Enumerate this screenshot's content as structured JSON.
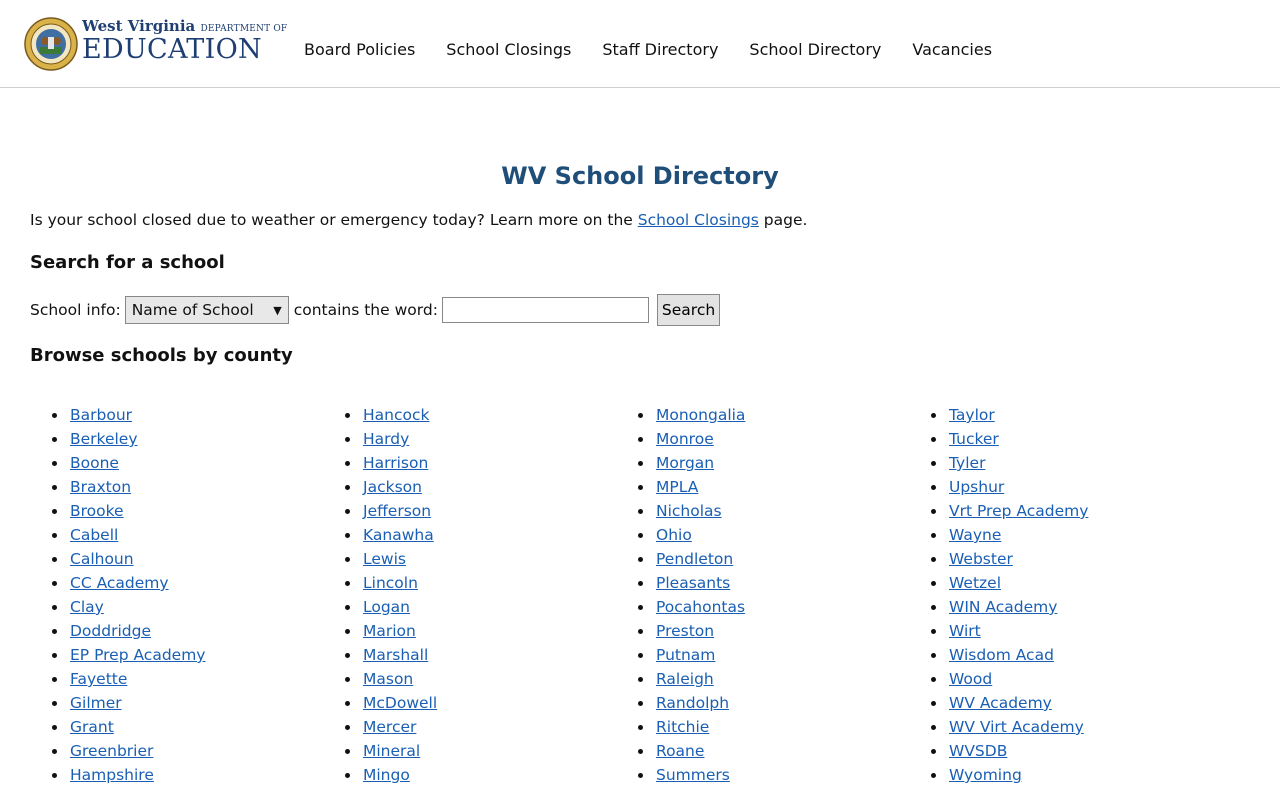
{
  "header": {
    "logo_line1": "West Virginia",
    "logo_dept": "DEPARTMENT OF",
    "logo_line2": "EDUCATION",
    "nav": [
      "Board Policies",
      "School Closings",
      "Staff Directory",
      "School Directory",
      "Vacancies"
    ]
  },
  "page": {
    "title": "WV School Directory",
    "notice_prefix": "Is your school closed due to weather or emergency today? Learn more on the ",
    "notice_link": "School Closings",
    "notice_suffix": " page."
  },
  "search": {
    "heading": "Search for a school",
    "field_label": "School info:",
    "selected_option": "Name of School",
    "contains_label": "contains the word:",
    "input_value": "",
    "button_label": "Search"
  },
  "browse": {
    "heading": "Browse schools by county",
    "columns": [
      [
        "Barbour",
        "Berkeley",
        "Boone",
        "Braxton",
        "Brooke",
        "Cabell",
        "Calhoun",
        "CC Academy",
        "Clay",
        "Doddridge",
        "EP Prep Academy",
        "Fayette",
        "Gilmer",
        "Grant",
        "Greenbrier",
        "Hampshire"
      ],
      [
        "Hancock",
        "Hardy",
        "Harrison",
        "Jackson",
        "Jefferson",
        "Kanawha",
        "Lewis",
        "Lincoln",
        "Logan",
        "Marion",
        "Marshall",
        "Mason",
        "McDowell",
        "Mercer",
        "Mineral",
        "Mingo"
      ],
      [
        "Monongalia",
        "Monroe",
        "Morgan",
        "MPLA",
        "Nicholas",
        "Ohio",
        "Pendleton",
        "Pleasants",
        "Pocahontas",
        "Preston",
        "Putnam",
        "Raleigh",
        "Randolph",
        "Ritchie",
        "Roane",
        "Summers"
      ],
      [
        "Taylor",
        "Tucker",
        "Tyler",
        "Upshur",
        "Vrt Prep Academy",
        "Wayne",
        "Webster",
        "Wetzel",
        "WIN Academy",
        "Wirt",
        "Wisdom Acad",
        "Wood",
        "WV Academy",
        "WV Virt Academy",
        "WVSDB",
        "Wyoming"
      ]
    ]
  }
}
